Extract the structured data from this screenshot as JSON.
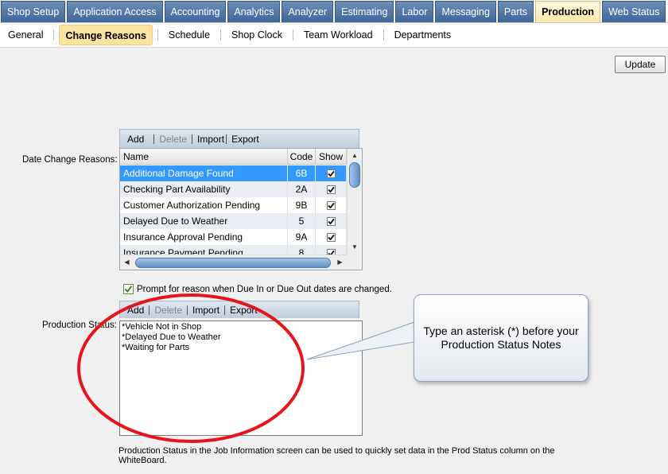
{
  "top_tabs": [
    {
      "label": "Shop Setup",
      "active": false
    },
    {
      "label": "Application Access",
      "active": false
    },
    {
      "label": "Accounting",
      "active": false
    },
    {
      "label": "Analytics",
      "active": false
    },
    {
      "label": "Analyzer",
      "active": false
    },
    {
      "label": "Estimating",
      "active": false
    },
    {
      "label": "Labor",
      "active": false
    },
    {
      "label": "Messaging",
      "active": false
    },
    {
      "label": "Parts",
      "active": false
    },
    {
      "label": "Production",
      "active": true
    },
    {
      "label": "Web Status",
      "active": false
    }
  ],
  "sub_tabs": [
    {
      "label": "General",
      "active": false
    },
    {
      "label": "Change Reasons",
      "active": true
    },
    {
      "label": "Schedule",
      "active": false
    },
    {
      "label": "Shop Clock",
      "active": false
    },
    {
      "label": "Team Workload",
      "active": false
    },
    {
      "label": "Departments",
      "active": false
    }
  ],
  "update_button": "Update",
  "date_change": {
    "label": "Date Change Reasons:",
    "toolbar": {
      "add": "Add",
      "delete": "Delete",
      "import": "Import",
      "export": "Export"
    },
    "columns": {
      "name": "Name",
      "code": "Code",
      "show": "Show"
    },
    "rows": [
      {
        "name": "Additional Damage Found",
        "code": "6B",
        "show": true,
        "selected": true
      },
      {
        "name": "Checking Part Availability",
        "code": "2A",
        "show": true,
        "selected": false
      },
      {
        "name": "Customer Authorization Pending",
        "code": "9B",
        "show": true,
        "selected": false
      },
      {
        "name": "Delayed Due to Weather",
        "code": "5",
        "show": true,
        "selected": false
      },
      {
        "name": "Insurance Approval Pending",
        "code": "9A",
        "show": true,
        "selected": false
      },
      {
        "name": "Insurance Payment Pending",
        "code": "8",
        "show": true,
        "selected": false
      }
    ]
  },
  "prompt_checkbox": {
    "label": "Prompt for reason when Due In or Due Out dates are changed.",
    "checked": true
  },
  "production_status": {
    "label": "Production Status:",
    "toolbar": {
      "add": "Add",
      "delete": "Delete",
      "import": "Import",
      "export": "Export"
    },
    "lines": [
      "*Vehicle Not in Shop",
      "*Delayed Due to Weather",
      "*Waiting for Parts"
    ]
  },
  "bottom_note": "Production Status in the Job Information screen can be used to quickly set data in the Prod Status column on the WhiteBoard.",
  "callout_text": "Type an asterisk (*) before your Production Status Notes",
  "colors": {
    "tab_blue": "#4f76a8",
    "tab_active": "#fbe9a7",
    "selection_blue": "#3399ff",
    "annotation_red": "#e8141c",
    "callout_border": "#8aa3c3"
  }
}
